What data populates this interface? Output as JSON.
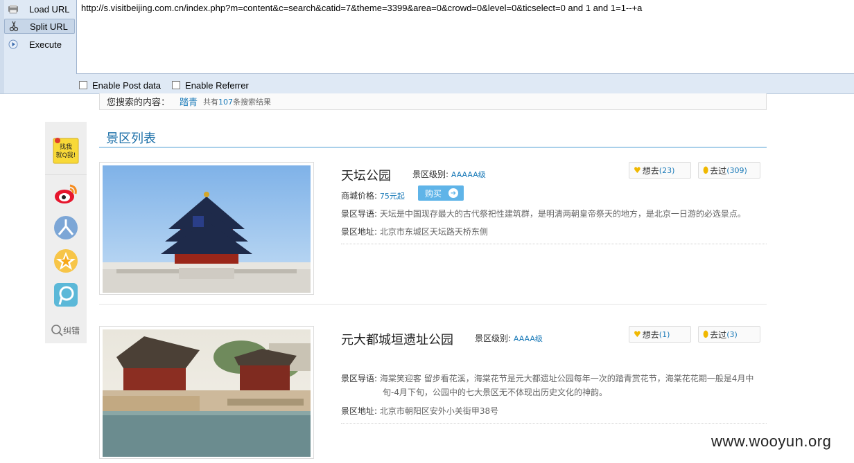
{
  "hackbar": {
    "load_url": "Load URL",
    "split_url": "Split URL",
    "execute": "Execute",
    "url": "http://s.visitbeijing.com.cn/index.php?m=content&c=search&catid=7&theme=3399&area=0&crowd=0&level=0&ticselect=0 and 1 and  1=1--+a",
    "enable_post": "Enable Post data",
    "enable_referrer": "Enable Referrer"
  },
  "search": {
    "label": "您搜索的内容：",
    "keyword": "踏青",
    "count_prefix": "共有",
    "count": "107",
    "count_suffix": "条搜索结果"
  },
  "section": {
    "title": "景区列表"
  },
  "share": {
    "report": "纠错",
    "icons": [
      "find-me-sticker-icon",
      "weibo-icon",
      "renren-icon",
      "qzone-icon",
      "kaixin-icon",
      "search-icon"
    ]
  },
  "items": [
    {
      "name": "天坛公园",
      "level_label": "景区级别:",
      "level": "AAAAA级",
      "price_label": "商城价格:",
      "price": "75元起",
      "buy": "购买",
      "guide_label": "景区导语:",
      "guide": "天坛是中国现存最大的古代祭祀性建筑群，是明清两朝皇帝祭天的地方，是北京一日游的必选景点。",
      "addr_label": "景区地址:",
      "addr": "北京市东城区天坛路天桥东侧",
      "want_label": "想去",
      "want": "(23)",
      "been_label": "去过",
      "been": "(309)"
    },
    {
      "name": "元大都城垣遗址公园",
      "level_label": "景区级别:",
      "level": "AAAA级",
      "guide_label": "景区导语:",
      "guide_line1": "海棠笑迎客  留步看花溪，海棠花节是元大都遗址公园每年一次的踏青赏花节，海棠花花期一般是4月中",
      "guide_line2": "旬-4月下旬，公园中的七大景区无不体现出历史文化的神韵。",
      "addr_label": "景区地址:",
      "addr": "北京市朝阳区安外小关街甲38号",
      "want_label": "想去",
      "want": "(1)",
      "been_label": "去过",
      "been": "(3)"
    }
  ],
  "watermark": "www.wooyun.org",
  "colors": {
    "link": "#1a7ab8",
    "title": "#1b6fa8",
    "buy": "#5fb4e8",
    "hackbar": "#dfe9f5"
  }
}
